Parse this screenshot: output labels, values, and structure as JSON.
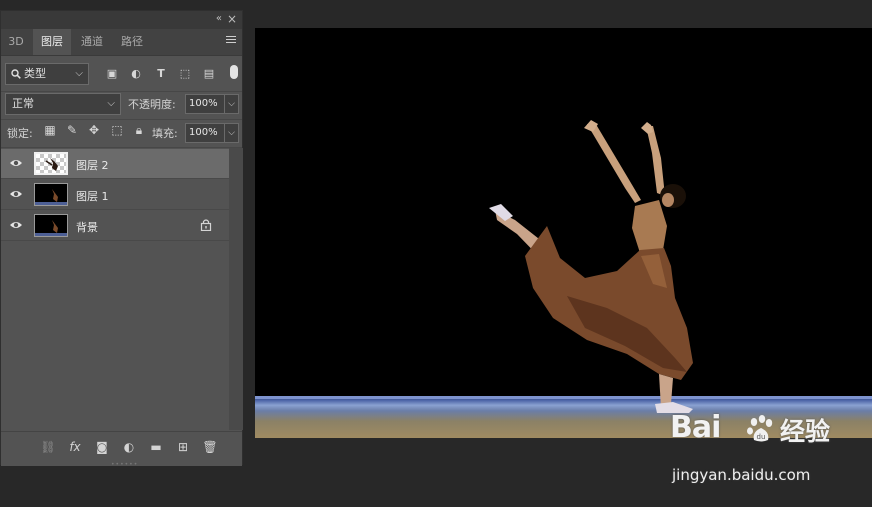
{
  "panel": {
    "collapse_glyph": "«",
    "close_glyph": "×",
    "tabs": [
      {
        "label": "3D"
      },
      {
        "label": "图层"
      },
      {
        "label": "通道"
      },
      {
        "label": "路径"
      }
    ],
    "filter": {
      "value": "类型"
    },
    "blend": {
      "mode": "正常",
      "opacity_label": "不透明度:",
      "opacity": "100%"
    },
    "lock": {
      "label": "锁定:",
      "fill_label": "填充:",
      "fill": "100%"
    },
    "layers": [
      {
        "name": "图层 2",
        "selected": true,
        "visible": true,
        "locked": false
      },
      {
        "name": "图层 1",
        "selected": false,
        "visible": true,
        "locked": false
      },
      {
        "name": "背景",
        "selected": false,
        "visible": true,
        "locked": true
      }
    ]
  },
  "watermark": {
    "logo": "Bai",
    "logo_cn": "经验",
    "url": "jingyan.baidu.com"
  },
  "colors": {
    "panel_bg": "#535353",
    "selected_layer": "#6b6b6b",
    "workspace": "#282828"
  }
}
